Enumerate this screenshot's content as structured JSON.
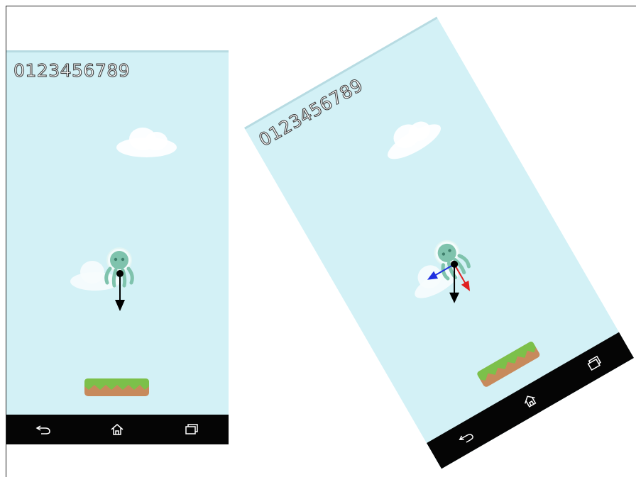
{
  "screens": [
    {
      "id": "upright",
      "score": "0123456789",
      "arrows": [
        {
          "name": "gravity",
          "color": "#000000"
        }
      ],
      "navbar": [
        "back-icon",
        "home-icon",
        "recent-apps-icon"
      ]
    },
    {
      "id": "tilted",
      "score": "0123456789",
      "arrows": [
        {
          "name": "gravity",
          "color": "#000000"
        },
        {
          "name": "device-x-axis",
          "color": "#e02020"
        },
        {
          "name": "device-y-axis",
          "color": "#1f2fe0"
        }
      ],
      "navbar": [
        "back-icon",
        "home-icon",
        "recent-apps-icon"
      ]
    }
  ],
  "colors": {
    "sky": "#d3f1f6",
    "navbar": "#050505",
    "grass": "#7cc04a",
    "dirt": "#c78a5c",
    "alien": "#7fc3ad"
  }
}
